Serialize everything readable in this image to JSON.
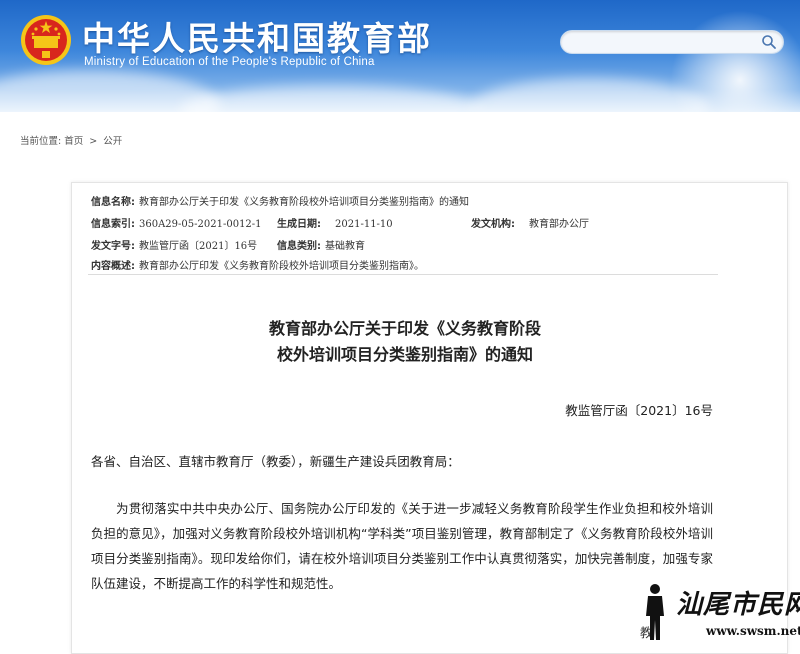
{
  "header": {
    "title": "中华人民共和国教育部",
    "subtitle": "Ministry of Education of the People's Republic of China",
    "search": {
      "value": "",
      "placeholder": ""
    }
  },
  "breadcrumb": {
    "prefix": "当前位置:",
    "items": [
      "首页",
      "公开"
    ],
    "separator": ">"
  },
  "meta": {
    "info_name_label": "信息名称:",
    "info_name_value": "教育部办公厅关于印发《义务教育阶段校外培训项目分类鉴别指南》的通知",
    "index_label": "信息索引:",
    "index_value": "360A29-05-2021-0012-1",
    "date_label": "生成日期:",
    "date_value": "2021-11-10",
    "issuer_label": "发文机构:",
    "issuer_value": "教育部办公厅",
    "doc_no_label": "发文字号:",
    "doc_no_value": "教监管厅函〔2021〕16号",
    "category_label": "信息类别:",
    "category_value": "基础教育",
    "summary_label": "内容概述:",
    "summary_value": "教育部办公厅印发《义务教育阶段校外培训项目分类鉴别指南》。"
  },
  "document": {
    "title_line1": "教育部办公厅关于印发《义务教育阶段",
    "title_line2": "校外培训项目分类鉴别指南》的通知",
    "doc_number": "教监管厅函〔2021〕16号",
    "salutation": "各省、自治区、直辖市教育厅（教委），新疆生产建设兵团教育局：",
    "body": "为贯彻落实中共中央办公厅、国务院办公厅印发的《关于进一步减轻义务教育阶段学生作业负担和校外培训负担的意见》，加强对义务教育阶段校外培训机构“学科类”项目鉴别管理，教育部制定了《义务教育阶段校外培训项目分类鉴别指南》。现印发给你们，请在校外培训项目分类鉴别工作中认真贯彻落实，加快完善制度，加强专家队伍建设，不断提高工作的科学性和规范性。",
    "trailing_sign": "教"
  },
  "watermark": {
    "brand": "汕尾市民网",
    "url": "www.swsm.net"
  },
  "colors": {
    "banner_top": "#1f68c8",
    "banner_bottom": "#d6e8fa",
    "emblem_red": "#d8261d",
    "emblem_gold": "#f5c518"
  },
  "icons": {
    "emblem": "national-emblem-icon",
    "search": "search-icon"
  }
}
